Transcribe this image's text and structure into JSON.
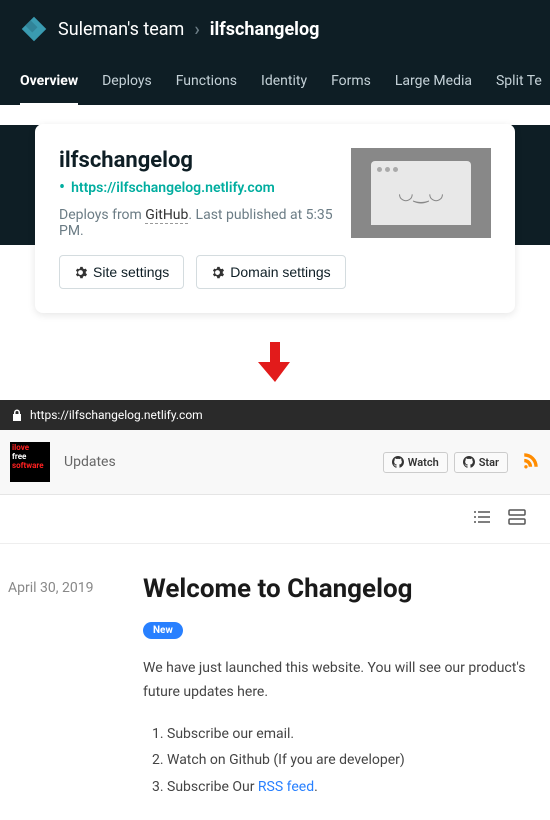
{
  "netlify": {
    "team_name": "Suleman's team",
    "project_name": "ilfschangelog",
    "tabs": [
      "Overview",
      "Deploys",
      "Functions",
      "Identity",
      "Forms",
      "Large Media",
      "Split Te"
    ],
    "card": {
      "title": "ilfschangelog",
      "url": "https://ilfschangelog.netlify.com",
      "deploy_prefix": "Deploys from ",
      "deploy_source": "GitHub",
      "deploy_suffix": ". Last published at 5:35 PM.",
      "btn_site": "Site settings",
      "btn_domain": "Domain settings"
    }
  },
  "browser": {
    "url": "https://ilfschangelog.netlify.com"
  },
  "site": {
    "brand_l1": "ilove",
    "brand_l2": "free",
    "brand_l3": "software",
    "nav": "Updates",
    "watch": "Watch",
    "star": "Star"
  },
  "post": {
    "date": "April 30, 2019",
    "title": "Welcome to Changelog",
    "badge": "New",
    "intro": "We have just launched this website. You will see our product's future updates here.",
    "li1": "Subscribe our email.",
    "li2": "Watch on Github (If you are developer)",
    "li3_a": "Subscribe Our ",
    "li3_link": "RSS feed",
    "li3_b": "."
  }
}
